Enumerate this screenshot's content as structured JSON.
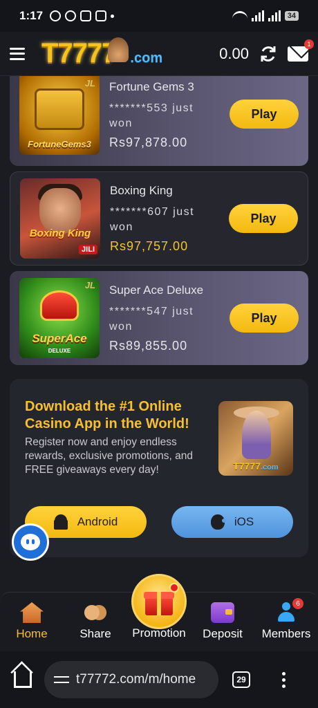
{
  "status_bar": {
    "time": "1:17",
    "battery": "34"
  },
  "header": {
    "logo_main": "T7777",
    "logo_suffix": ".com",
    "balance": "0.00",
    "mail_badge": "1"
  },
  "games": [
    {
      "name": "Fortune Gems 3",
      "winner": "*******553 just won",
      "amount": "Rs97,878.00",
      "thumb_label": "FortuneGems3",
      "provider": "JL",
      "button": "Play"
    },
    {
      "name": "Boxing King",
      "winner": "*******607 just won",
      "amount": "Rs97,757.00",
      "thumb_label": "Boxing King",
      "provider": "JILI",
      "button": "Play"
    },
    {
      "name": "Super Ace Deluxe",
      "winner": "*******547 just won",
      "amount": "Rs89,855.00",
      "thumb_label": "SuperAce",
      "thumb_sub": "DELUXE",
      "provider": "JL",
      "button": "Play"
    }
  ],
  "promo": {
    "title": "Download the #1 Online Casino App in the World!",
    "description": "Register now and enjoy endless rewards, exclusive promotions, and FREE giveaways every day!",
    "image_logo_main": "T7777",
    "image_logo_suffix": ".com",
    "android_label": "Android",
    "ios_label": "iOS"
  },
  "bottom_nav": {
    "home": "Home",
    "share": "Share",
    "promotion": "Promotion",
    "deposit": "Deposit",
    "members": "Members",
    "members_badge": "6"
  },
  "browser": {
    "url": "t77772.com/m/home",
    "tab_count": "29"
  },
  "colors": {
    "accent_gold": "#f6c02f",
    "ios_blue": "#4f93dd",
    "background": "#1b1c22"
  }
}
